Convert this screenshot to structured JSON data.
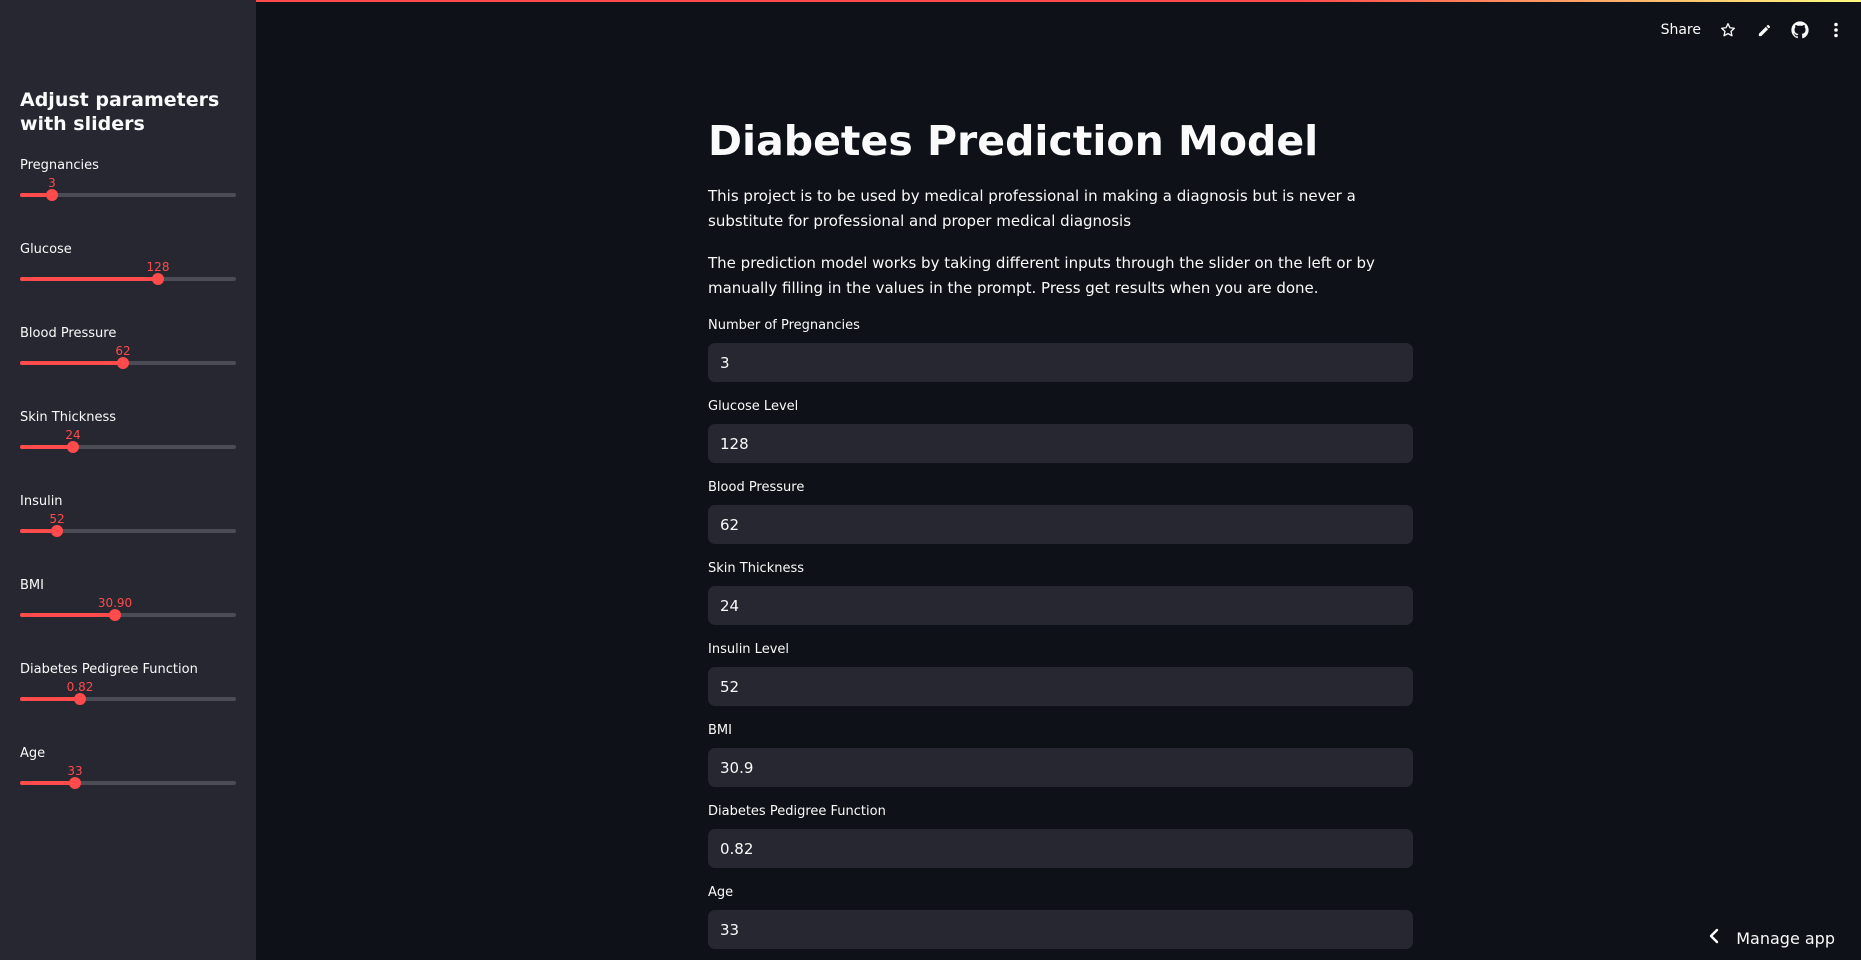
{
  "header": {
    "share_label": "Share",
    "icons": [
      "star-icon",
      "pencil-icon",
      "github-icon",
      "more-vertical-icon"
    ]
  },
  "sidebar": {
    "title": "Adjust parameters with sliders",
    "sliders": [
      {
        "label": "Pregnancies",
        "value": "3",
        "fraction": 0.148
      },
      {
        "label": "Glucose",
        "value": "128",
        "fraction": 0.64
      },
      {
        "label": "Blood Pressure",
        "value": "62",
        "fraction": 0.476
      },
      {
        "label": "Skin Thickness",
        "value": "24",
        "fraction": 0.244
      },
      {
        "label": "Insulin",
        "value": "52",
        "fraction": 0.172
      },
      {
        "label": "BMI",
        "value": "30.90",
        "fraction": 0.44
      },
      {
        "label": "Diabetes Pedigree Function",
        "value": "0.82",
        "fraction": 0.276
      },
      {
        "label": "Age",
        "value": "33",
        "fraction": 0.256
      }
    ]
  },
  "main": {
    "title": "Diabetes Prediction Model",
    "paragraph_1": "This project is to be used by medical professional in making a diagnosis but is never a substitute for professional and proper medical diagnosis",
    "paragraph_2": "The prediction model works by taking different inputs through the slider on the left or by manually filling in the values in the prompt. Press get results when you are done.",
    "fields": [
      {
        "label": "Number of Pregnancies",
        "value": "3"
      },
      {
        "label": "Glucose Level",
        "value": "128"
      },
      {
        "label": "Blood Pressure",
        "value": "62"
      },
      {
        "label": "Skin Thickness",
        "value": "24"
      },
      {
        "label": "Insulin Level",
        "value": "52"
      },
      {
        "label": "BMI",
        "value": "30.9"
      },
      {
        "label": "Diabetes Pedigree Function",
        "value": "0.82"
      },
      {
        "label": "Age",
        "value": "33"
      }
    ]
  },
  "footer": {
    "manage_label": "Manage app"
  },
  "colors": {
    "accent": "#ff4b4b",
    "background": "#0e1117",
    "sidebar_bg": "#262730",
    "input_bg": "#262730"
  }
}
